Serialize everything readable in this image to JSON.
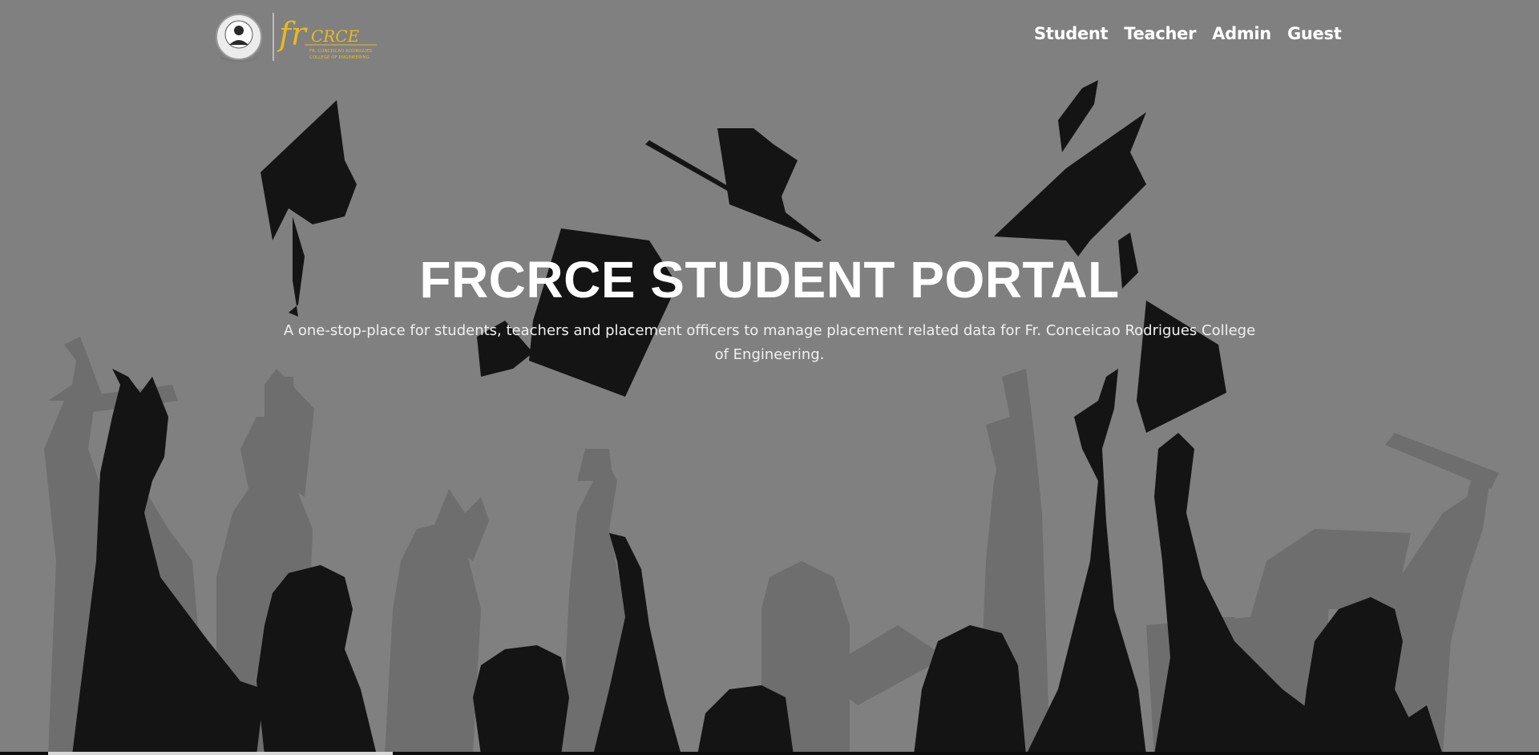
{
  "header": {
    "logo_text": "fr.CRCE",
    "logo_subtext": "FR. CONCEICAO RODRIGUES COLLEGE OF ENGINEERING"
  },
  "nav": {
    "items": [
      {
        "label": "Student"
      },
      {
        "label": "Teacher"
      },
      {
        "label": "Admin"
      },
      {
        "label": "Guest"
      }
    ]
  },
  "hero": {
    "title": "FRCRCE STUDENT PORTAL",
    "subtitle": "A one-stop-place for students, teachers and placement officers to manage placement related data for Fr. Conceicao Rodrigues College of Engineering."
  },
  "colors": {
    "background": "#808080",
    "silhouette_dark": "#141414",
    "silhouette_light": "#6b6b6b",
    "logo_gold": "#e8b923",
    "text": "#ffffff"
  }
}
